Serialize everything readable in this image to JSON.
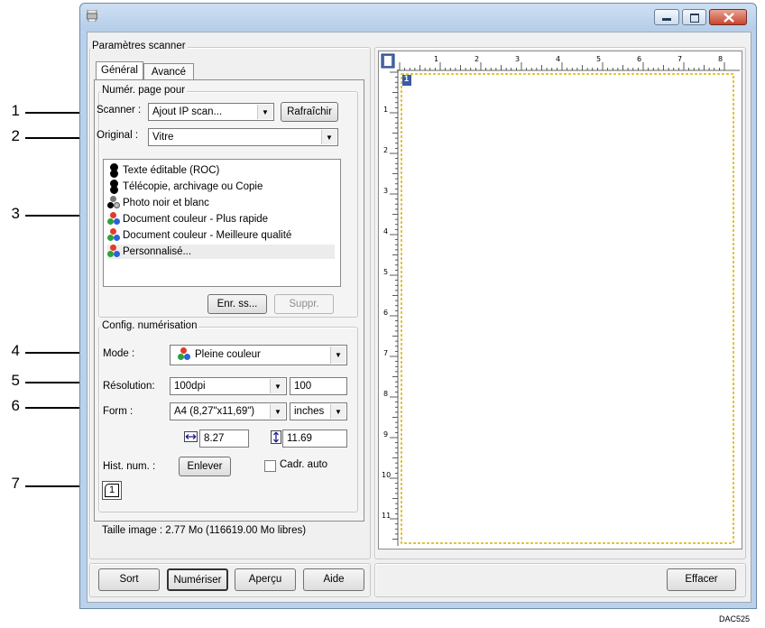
{
  "window": {
    "title": ""
  },
  "scanner_settings": {
    "group_title": "Paramètres scanner",
    "tabs": [
      {
        "label": "Général"
      },
      {
        "label": "Avancé"
      }
    ],
    "scan_for": {
      "group_title": "Numér. page pour",
      "scanner_label": "Scanner :",
      "scanner_value": "Ajout IP scan...",
      "refresh_label": "Rafraîchir",
      "original_label": "Original :",
      "original_value": "Vitre",
      "presets": [
        {
          "label": "Texte éditable (ROC)",
          "icon": "bw"
        },
        {
          "label": "Télécopie, archivage ou Copie",
          "icon": "bw"
        },
        {
          "label": "Photo noir et blanc",
          "icon": "gray"
        },
        {
          "label": "Document couleur - Plus rapide",
          "icon": "color"
        },
        {
          "label": "Document couleur - Meilleure qualité",
          "icon": "color"
        },
        {
          "label": "Personnalisé...",
          "icon": "color",
          "selected": true
        }
      ],
      "save_label": "Enr. ss...",
      "delete_label": "Suppr."
    },
    "scan_config": {
      "group_title": "Config. numérisation",
      "mode_label": "Mode :",
      "mode_value": "Pleine couleur",
      "resolution_label": "Résolution:",
      "resolution_value": "100dpi",
      "resolution_custom": "100",
      "form_label": "Form :",
      "form_value": "A4 (8,27\"x11,69\")",
      "unit_value": "inches",
      "width_value": "8.27",
      "height_value": "11.69",
      "history_label": "Hist. num. :",
      "remove_label": "Enlever",
      "auto_frame_label": "Cadr. auto",
      "page_number": "1"
    },
    "image_size_text": "Taille image : 2.77 Mo (116619.00 Mo libres)"
  },
  "buttons": {
    "sort": "Sort",
    "scan": "Numériser",
    "preview": "Aperçu",
    "help": "Aide",
    "clear": "Effacer"
  },
  "preview": {
    "ruler_h": [
      "1",
      "2",
      "3",
      "4",
      "5",
      "6",
      "7",
      "8"
    ],
    "ruler_v": [
      "1",
      "2",
      "3",
      "4",
      "5",
      "6",
      "7",
      "8",
      "9",
      "10",
      "11"
    ],
    "page_marker": "1"
  },
  "callouts": [
    "1",
    "2",
    "3",
    "4",
    "5",
    "6",
    "7"
  ],
  "figure_code": "DAC525",
  "colors": {
    "window_frame": "#b9d1ea",
    "close_button": "#c7452f",
    "crop_frame": "#d4b400"
  }
}
